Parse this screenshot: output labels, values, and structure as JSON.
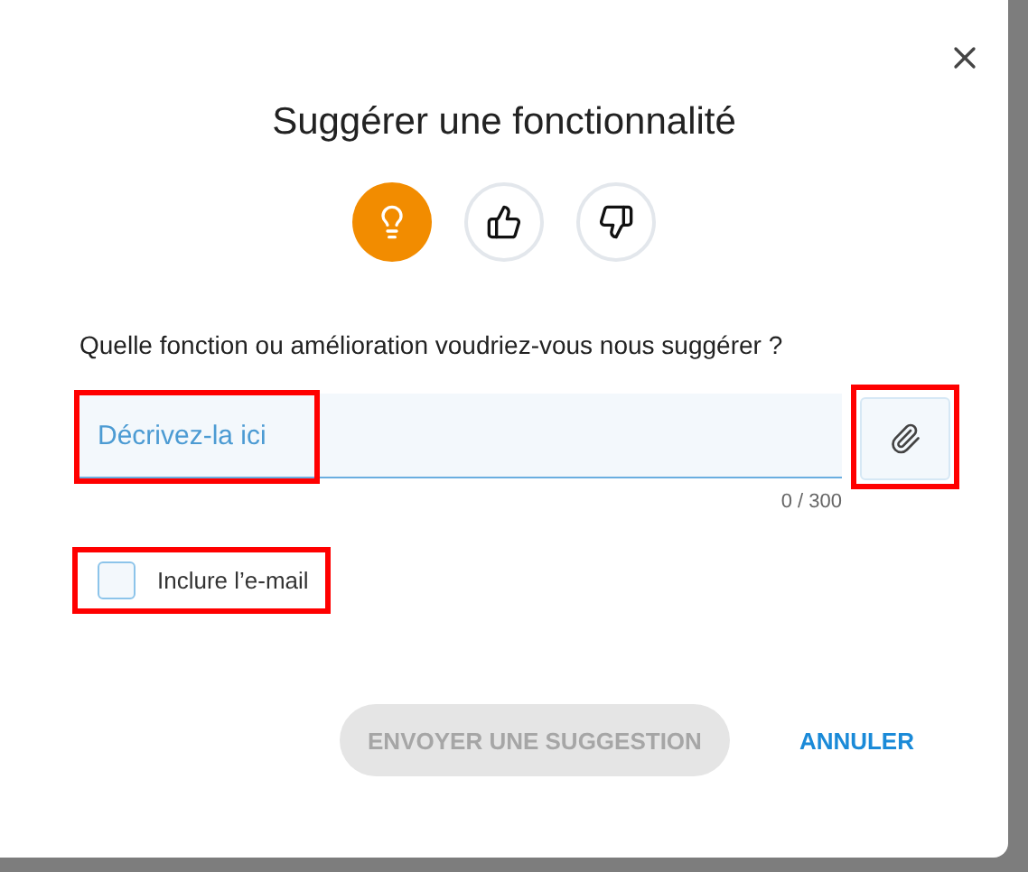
{
  "dialog": {
    "title": "Suggérer une fonctionnalité"
  },
  "feedback_types": [
    {
      "kind": "idea",
      "selected": true
    },
    {
      "kind": "like",
      "selected": false
    },
    {
      "kind": "dislike",
      "selected": false
    }
  ],
  "question": "Quelle fonction ou amélioration voudriez-vous nous suggérer ?",
  "description_field": {
    "placeholder": "Décrivez-la ici",
    "highlighted": true
  },
  "attach_button": {
    "highlighted": true
  },
  "counter": "0 / 300",
  "include_email": {
    "label": "Inclure l’e-mail",
    "checked": false,
    "highlighted": true
  },
  "buttons": [
    {
      "kind": "primary",
      "label": "ENVOYER UNE SUGGESTION",
      "disabled": true
    },
    {
      "kind": "text",
      "label": "ANNULER",
      "disabled": false
    }
  ]
}
